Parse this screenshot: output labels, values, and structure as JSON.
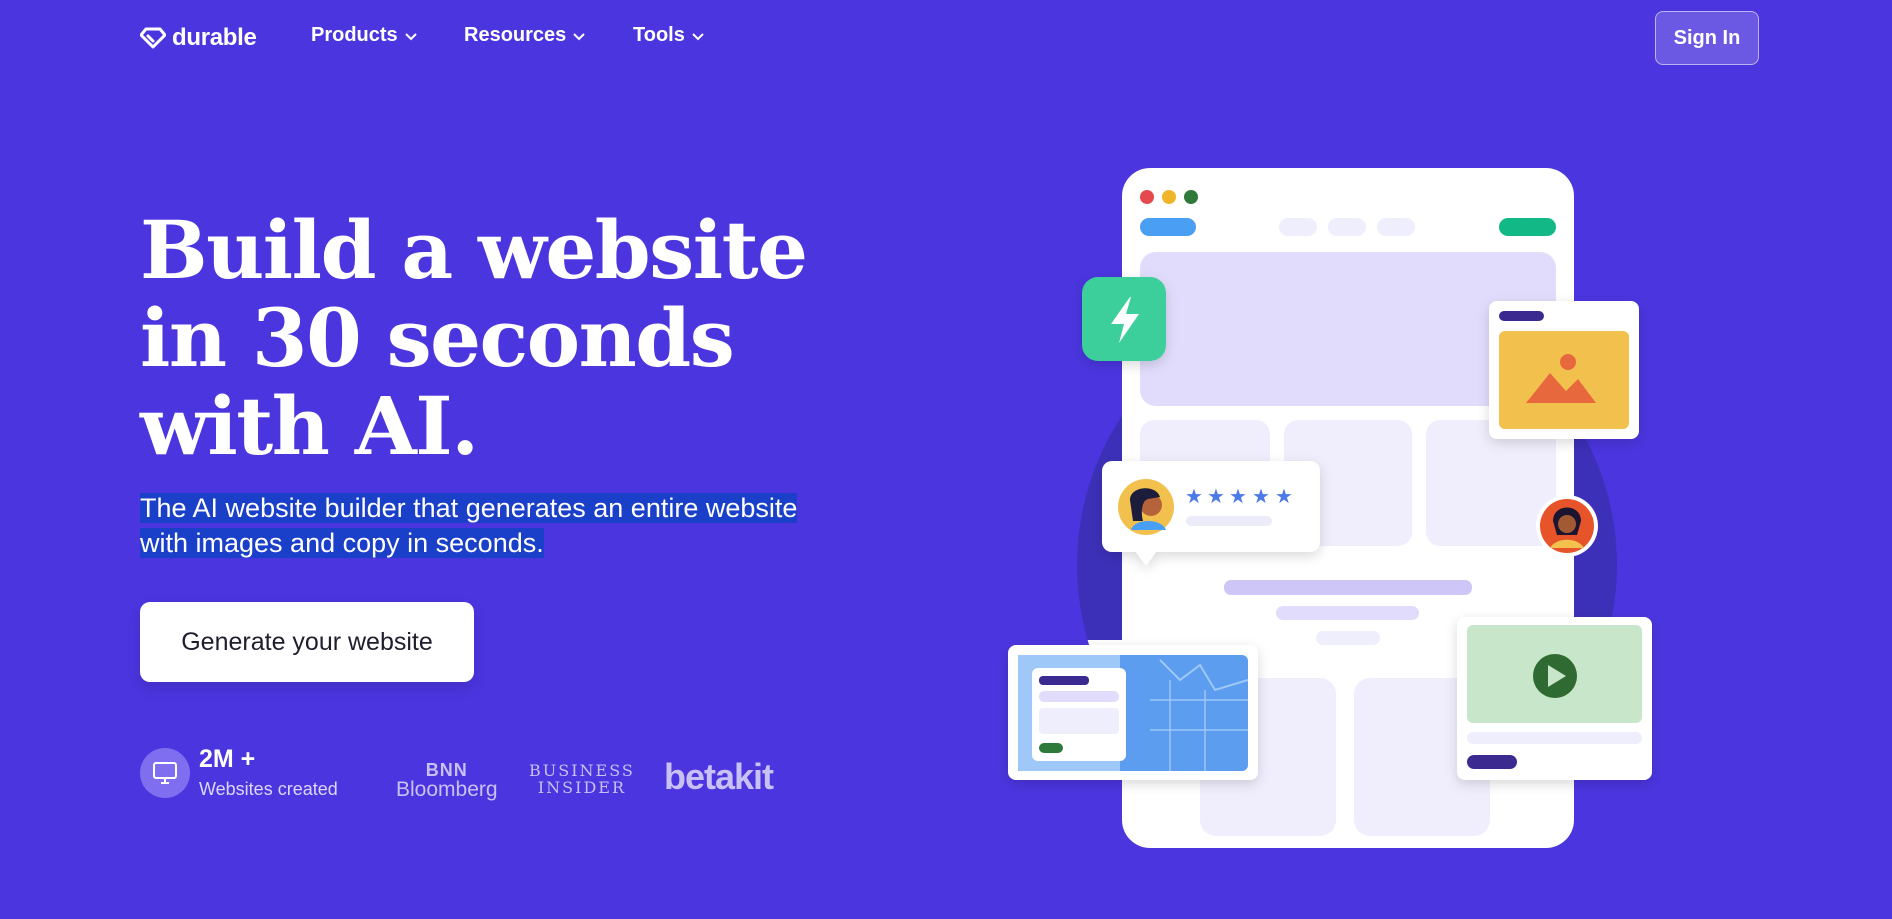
{
  "nav": {
    "logo_text": "durable",
    "items": [
      {
        "label": "Products"
      },
      {
        "label": "Resources"
      },
      {
        "label": "Tools"
      }
    ],
    "sign_in_label": "Sign In"
  },
  "hero": {
    "headline_lines": [
      "Build a website",
      "in 30 seconds",
      "with AI."
    ],
    "subtitle_lines": [
      "The AI website builder that generates an entire website",
      "with images and copy in seconds."
    ],
    "cta_label": "Generate your website"
  },
  "stats": {
    "number": "2M +",
    "label": "Websites created"
  },
  "press": {
    "bnn_line1": "BNN",
    "bnn_line2": "Bloomberg",
    "bi_line1": "BUSINESS",
    "bi_line2": "INSIDER",
    "betakit": "betakit"
  },
  "illustration": {
    "review_rating_stars": 5
  },
  "colors": {
    "background": "#4b35df",
    "subtitle_highlight": "#1a3fc9",
    "bolt_badge": "#3ccf9b",
    "accent_green": "#10b981",
    "image_card": "#f2c14e",
    "video_card": "#c8e6c9"
  }
}
